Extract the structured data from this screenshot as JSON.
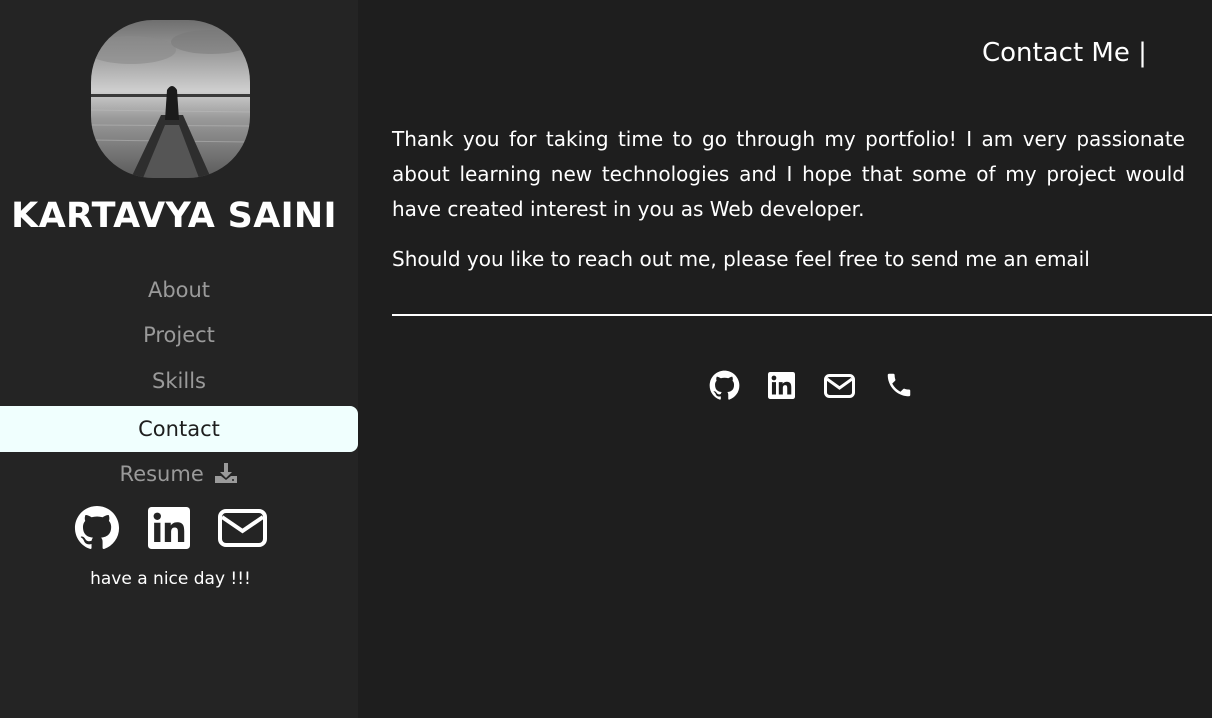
{
  "profile": {
    "name": "KARTAVYA SAINI",
    "avatar_alt": "person on boat"
  },
  "nav": {
    "items": [
      {
        "label": "About"
      },
      {
        "label": "Project"
      },
      {
        "label": "Skills"
      },
      {
        "label": "Contact"
      },
      {
        "label": "Resume"
      }
    ],
    "active": "Contact"
  },
  "sidebar_social": {
    "icons": [
      "github-icon",
      "linkedin-icon",
      "mail-icon"
    ]
  },
  "tagline": "have a nice day !!!",
  "contact": {
    "title": "Contact Me |",
    "paragraph1": "Thank you for taking time to go through my portfolio! I am very passionate about learning new technologies and I hope that some of my project would have created interest in you as Web developer.",
    "paragraph2": "Should you like to reach out me, please feel free to send me an email",
    "icons": [
      "github-icon",
      "linkedin-icon",
      "mail-icon",
      "phone-icon"
    ]
  },
  "colors": {
    "background": "#1e1e1e",
    "sidebar": "#242424",
    "active_nav": "#f0fffe",
    "nav_text": "#9a9a9a"
  }
}
